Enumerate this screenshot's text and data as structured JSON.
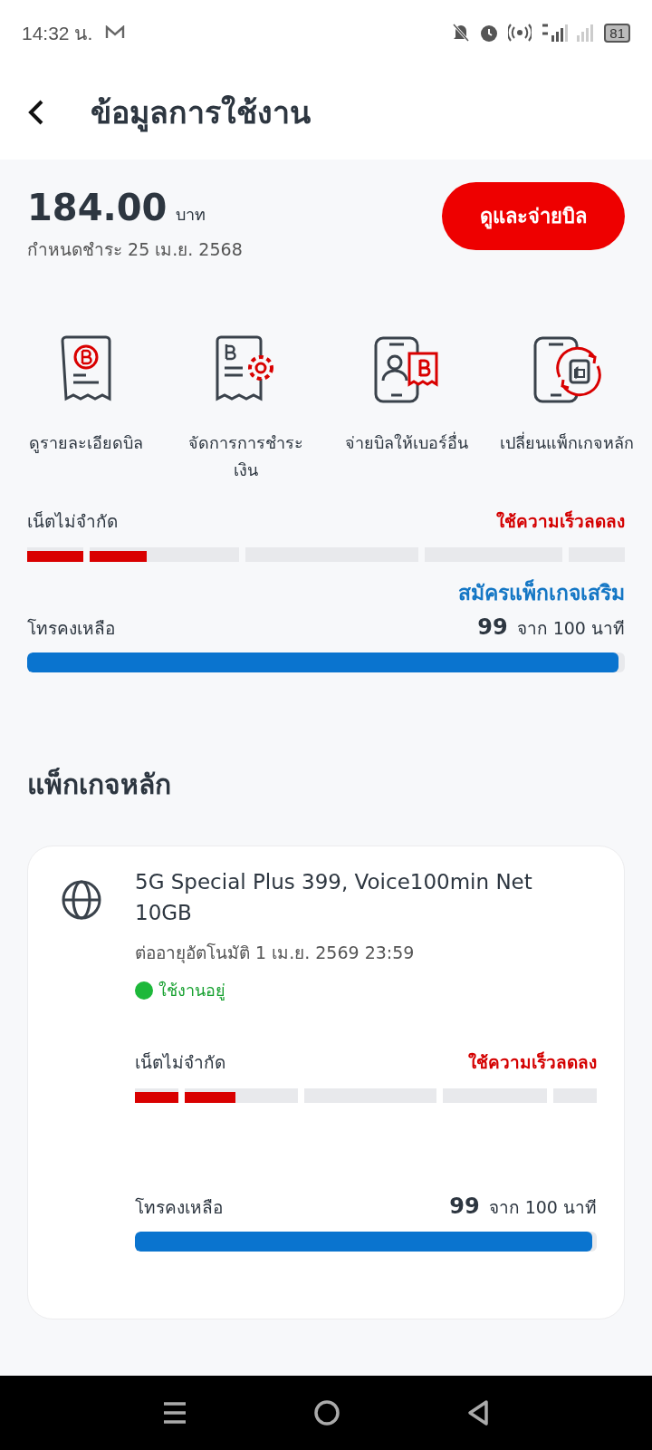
{
  "status_bar": {
    "time": "14:32 น.",
    "battery": "81"
  },
  "header": {
    "title": "ข้อมูลการใช้งาน"
  },
  "bill": {
    "amount": "184.00",
    "currency": "บาท",
    "due": "กำหนดชำระ 25 เม.ย. 2568",
    "pay_button": "ดูและจ่ายบิล"
  },
  "shortcuts": [
    {
      "kind": "bill-detail",
      "label": "ดูรายละเอียดบิล"
    },
    {
      "kind": "payment-settings",
      "label": "จัดการการชำระเงิน"
    },
    {
      "kind": "pay-other",
      "label": "จ่ายบิลให้เบอร์อื่น"
    },
    {
      "kind": "change-package",
      "label": "เปลี่ยนแพ็กเกจหลัก"
    }
  ],
  "usage": {
    "data": {
      "label": "เน็ตไม่จำกัด",
      "status": "ใช้ความเร็วลดลง",
      "segments": [
        {
          "level": 1
        },
        {
          "level": 0.38
        }
      ]
    },
    "addon_link": "สมัครแพ็กเกจเสริม",
    "voice": {
      "label": "โทรคงเหลือ",
      "remaining": "99",
      "total": "จาก 100 นาที",
      "level": 0.99
    }
  },
  "main_package": {
    "heading": "แพ็กเกจหลัก",
    "name": "5G Special Plus 399, Voice100min Net 10GB",
    "renewal": "ต่ออายุอัตโนมัติ 1 เม.ย. 2569 23:59",
    "status": "ใช้งานอยู่",
    "active": true,
    "data": {
      "label": "เน็ตไม่จำกัด",
      "status": "ใช้ความเร็วลดลง",
      "segments": [
        {
          "level": 1
        },
        {
          "level": 0.45
        }
      ]
    },
    "voice": {
      "label": "โทรคงเหลือ",
      "remaining": "99",
      "total": "จาก 100 นาที",
      "level": 0.99
    }
  }
}
